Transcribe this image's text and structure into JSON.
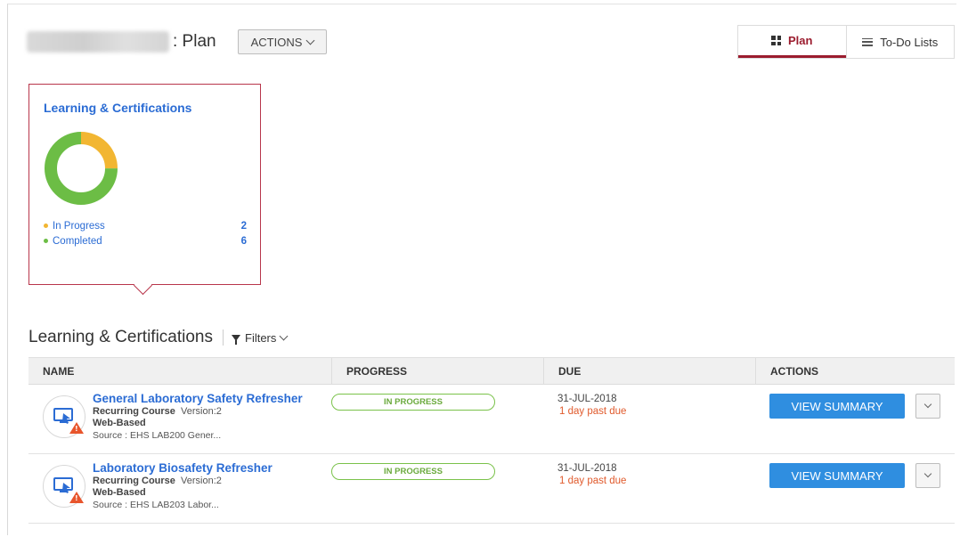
{
  "header": {
    "title": ": Plan",
    "actions_label": "ACTIONS"
  },
  "tabs": [
    {
      "label": "Plan",
      "icon": "dashboard-grid-icon",
      "active": true
    },
    {
      "label": "To-Do Lists",
      "icon": "list-icon",
      "active": false
    }
  ],
  "summary": {
    "title": "Learning & Certifications",
    "legend": [
      {
        "label": "In Progress",
        "count": "2",
        "color": "#f2b632"
      },
      {
        "label": "Completed",
        "count": "6",
        "color": "#6cbd45"
      }
    ]
  },
  "chart_data": {
    "type": "pie",
    "categories": [
      "In Progress",
      "Completed"
    ],
    "values": [
      2,
      6
    ],
    "colors": [
      "#f2b632",
      "#6cbd45"
    ]
  },
  "section": {
    "title": "Learning & Certifications",
    "filters_label": "Filters"
  },
  "table": {
    "columns": [
      "NAME",
      "PROGRESS",
      "DUE",
      "ACTIONS"
    ],
    "rows": [
      {
        "name": "General Laboratory Safety Refresher",
        "type": "Recurring Course",
        "version": "Version:2",
        "delivery": "Web-Based",
        "source": "Source : EHS LAB200 Gener...",
        "progress": "IN PROGRESS",
        "due_date": "31-JUL-2018",
        "due_status": "1 day past due",
        "action": "VIEW SUMMARY"
      },
      {
        "name": "Laboratory Biosafety Refresher",
        "type": "Recurring Course",
        "version": "Version:2",
        "delivery": "Web-Based",
        "source": "Source : EHS LAB203 Labor...",
        "progress": "IN PROGRESS",
        "due_date": "31-JUL-2018",
        "due_status": "1 day past due",
        "action": "VIEW SUMMARY"
      }
    ]
  }
}
